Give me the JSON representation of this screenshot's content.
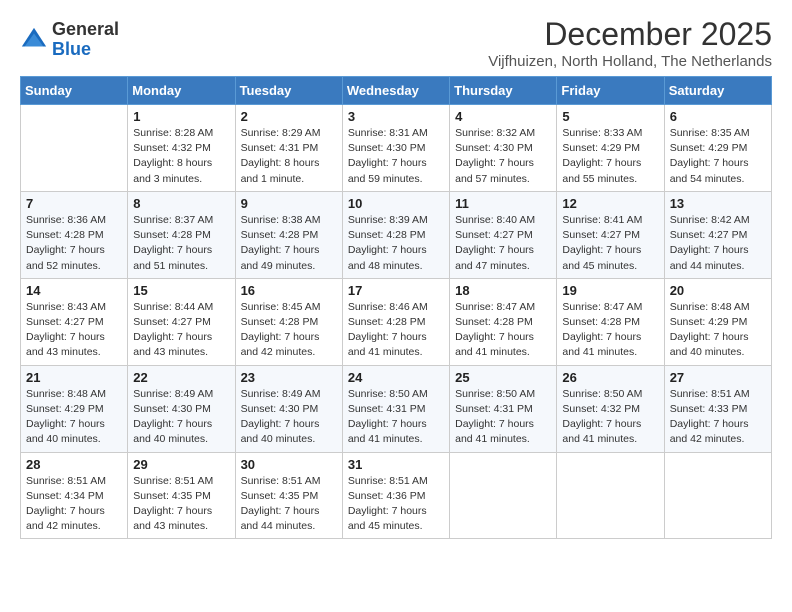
{
  "logo": {
    "general": "General",
    "blue": "Blue"
  },
  "header": {
    "month": "December 2025",
    "location": "Vijfhuizen, North Holland, The Netherlands"
  },
  "days_of_week": [
    "Sunday",
    "Monday",
    "Tuesday",
    "Wednesday",
    "Thursday",
    "Friday",
    "Saturday"
  ],
  "weeks": [
    [
      {
        "day": "",
        "info": ""
      },
      {
        "day": "1",
        "info": "Sunrise: 8:28 AM\nSunset: 4:32 PM\nDaylight: 8 hours\nand 3 minutes."
      },
      {
        "day": "2",
        "info": "Sunrise: 8:29 AM\nSunset: 4:31 PM\nDaylight: 8 hours\nand 1 minute."
      },
      {
        "day": "3",
        "info": "Sunrise: 8:31 AM\nSunset: 4:30 PM\nDaylight: 7 hours\nand 59 minutes."
      },
      {
        "day": "4",
        "info": "Sunrise: 8:32 AM\nSunset: 4:30 PM\nDaylight: 7 hours\nand 57 minutes."
      },
      {
        "day": "5",
        "info": "Sunrise: 8:33 AM\nSunset: 4:29 PM\nDaylight: 7 hours\nand 55 minutes."
      },
      {
        "day": "6",
        "info": "Sunrise: 8:35 AM\nSunset: 4:29 PM\nDaylight: 7 hours\nand 54 minutes."
      }
    ],
    [
      {
        "day": "7",
        "info": "Sunrise: 8:36 AM\nSunset: 4:28 PM\nDaylight: 7 hours\nand 52 minutes."
      },
      {
        "day": "8",
        "info": "Sunrise: 8:37 AM\nSunset: 4:28 PM\nDaylight: 7 hours\nand 51 minutes."
      },
      {
        "day": "9",
        "info": "Sunrise: 8:38 AM\nSunset: 4:28 PM\nDaylight: 7 hours\nand 49 minutes."
      },
      {
        "day": "10",
        "info": "Sunrise: 8:39 AM\nSunset: 4:28 PM\nDaylight: 7 hours\nand 48 minutes."
      },
      {
        "day": "11",
        "info": "Sunrise: 8:40 AM\nSunset: 4:27 PM\nDaylight: 7 hours\nand 47 minutes."
      },
      {
        "day": "12",
        "info": "Sunrise: 8:41 AM\nSunset: 4:27 PM\nDaylight: 7 hours\nand 45 minutes."
      },
      {
        "day": "13",
        "info": "Sunrise: 8:42 AM\nSunset: 4:27 PM\nDaylight: 7 hours\nand 44 minutes."
      }
    ],
    [
      {
        "day": "14",
        "info": "Sunrise: 8:43 AM\nSunset: 4:27 PM\nDaylight: 7 hours\nand 43 minutes."
      },
      {
        "day": "15",
        "info": "Sunrise: 8:44 AM\nSunset: 4:27 PM\nDaylight: 7 hours\nand 43 minutes."
      },
      {
        "day": "16",
        "info": "Sunrise: 8:45 AM\nSunset: 4:28 PM\nDaylight: 7 hours\nand 42 minutes."
      },
      {
        "day": "17",
        "info": "Sunrise: 8:46 AM\nSunset: 4:28 PM\nDaylight: 7 hours\nand 41 minutes."
      },
      {
        "day": "18",
        "info": "Sunrise: 8:47 AM\nSunset: 4:28 PM\nDaylight: 7 hours\nand 41 minutes."
      },
      {
        "day": "19",
        "info": "Sunrise: 8:47 AM\nSunset: 4:28 PM\nDaylight: 7 hours\nand 41 minutes."
      },
      {
        "day": "20",
        "info": "Sunrise: 8:48 AM\nSunset: 4:29 PM\nDaylight: 7 hours\nand 40 minutes."
      }
    ],
    [
      {
        "day": "21",
        "info": "Sunrise: 8:48 AM\nSunset: 4:29 PM\nDaylight: 7 hours\nand 40 minutes."
      },
      {
        "day": "22",
        "info": "Sunrise: 8:49 AM\nSunset: 4:30 PM\nDaylight: 7 hours\nand 40 minutes."
      },
      {
        "day": "23",
        "info": "Sunrise: 8:49 AM\nSunset: 4:30 PM\nDaylight: 7 hours\nand 40 minutes."
      },
      {
        "day": "24",
        "info": "Sunrise: 8:50 AM\nSunset: 4:31 PM\nDaylight: 7 hours\nand 41 minutes."
      },
      {
        "day": "25",
        "info": "Sunrise: 8:50 AM\nSunset: 4:31 PM\nDaylight: 7 hours\nand 41 minutes."
      },
      {
        "day": "26",
        "info": "Sunrise: 8:50 AM\nSunset: 4:32 PM\nDaylight: 7 hours\nand 41 minutes."
      },
      {
        "day": "27",
        "info": "Sunrise: 8:51 AM\nSunset: 4:33 PM\nDaylight: 7 hours\nand 42 minutes."
      }
    ],
    [
      {
        "day": "28",
        "info": "Sunrise: 8:51 AM\nSunset: 4:34 PM\nDaylight: 7 hours\nand 42 minutes."
      },
      {
        "day": "29",
        "info": "Sunrise: 8:51 AM\nSunset: 4:35 PM\nDaylight: 7 hours\nand 43 minutes."
      },
      {
        "day": "30",
        "info": "Sunrise: 8:51 AM\nSunset: 4:35 PM\nDaylight: 7 hours\nand 44 minutes."
      },
      {
        "day": "31",
        "info": "Sunrise: 8:51 AM\nSunset: 4:36 PM\nDaylight: 7 hours\nand 45 minutes."
      },
      {
        "day": "",
        "info": ""
      },
      {
        "day": "",
        "info": ""
      },
      {
        "day": "",
        "info": ""
      }
    ]
  ]
}
